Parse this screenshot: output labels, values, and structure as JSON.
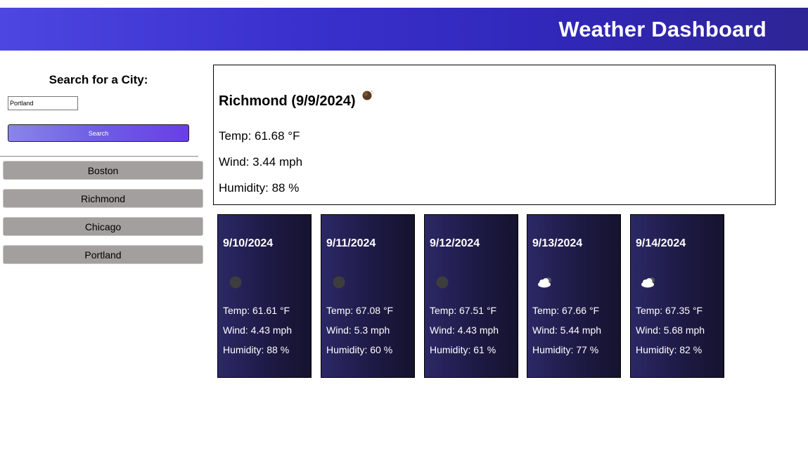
{
  "header": {
    "title": "Weather Dashboard"
  },
  "search": {
    "heading": "Search for a City:",
    "input_value": "Portland",
    "button_label": "Search"
  },
  "history": [
    {
      "label": "Boston"
    },
    {
      "label": "Richmond"
    },
    {
      "label": "Chicago"
    },
    {
      "label": "Portland"
    }
  ],
  "current": {
    "title": "Richmond (9/9/2024)",
    "icon": "moon-icon",
    "temp": "Temp: 61.68 °F",
    "wind": "Wind: 3.44 mph",
    "humidity": "Humidity: 88 %"
  },
  "forecast": [
    {
      "date": "9/10/2024",
      "icon": "moon-icon",
      "temp": "Temp: 61.61 °F",
      "wind": "Wind: 4.43 mph",
      "humidity": "Humidity: 88 %"
    },
    {
      "date": "9/11/2024",
      "icon": "moon-icon",
      "temp": "Temp: 67.08 °F",
      "wind": "Wind: 5.3 mph",
      "humidity": "Humidity: 60 %"
    },
    {
      "date": "9/12/2024",
      "icon": "moon-icon",
      "temp": "Temp: 67.51 °F",
      "wind": "Wind: 4.43 mph",
      "humidity": "Humidity: 61 %"
    },
    {
      "date": "9/13/2024",
      "icon": "cloud-night-icon",
      "temp": "Temp: 67.66 °F",
      "wind": "Wind: 5.44 mph",
      "humidity": "Humidity: 77 %"
    },
    {
      "date": "9/14/2024",
      "icon": "cloud-night-icon",
      "temp": "Temp: 67.35 °F",
      "wind": "Wind: 5.68 mph",
      "humidity": "Humidity: 82 %"
    }
  ],
  "colors": {
    "header_start": "#4e46e0",
    "header_end": "#2e2596",
    "search_button_start": "#8a85e8",
    "search_button_end": "#6a3ee6",
    "history_button": "#a39f9f",
    "forecast_card_start": "#2c2866",
    "forecast_card_end": "#15132e"
  }
}
